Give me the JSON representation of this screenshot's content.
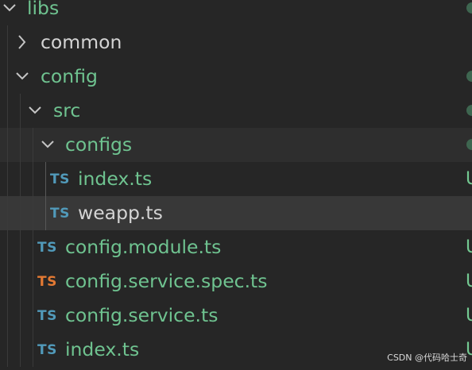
{
  "colors": {
    "background": "#262626",
    "folder_text": "#6fc390",
    "neutral_text": "#d4d4d4",
    "ts_blue": "#519aba",
    "ts_orange": "#e37933",
    "status_dot": "#3e6650",
    "untracked_badge": "#73c991"
  },
  "explorer": {
    "rows": [
      {
        "label": "libs",
        "type": "folder",
        "state": "expanded",
        "git": "dot"
      },
      {
        "label": "common",
        "type": "folder",
        "state": "collapsed",
        "git": "none"
      },
      {
        "label": "config",
        "type": "folder",
        "state": "expanded",
        "git": "dot"
      },
      {
        "label": "src",
        "type": "folder",
        "state": "expanded",
        "git": "dot"
      },
      {
        "label": "configs",
        "type": "folder",
        "state": "expanded",
        "git": "dot"
      },
      {
        "label": "index.ts",
        "type": "file",
        "icon": "TS",
        "icon_color": "blue",
        "git": "U"
      },
      {
        "label": "weapp.ts",
        "type": "file",
        "icon": "TS",
        "icon_color": "blue",
        "git": "none"
      },
      {
        "label": "config.module.ts",
        "type": "file",
        "icon": "TS",
        "icon_color": "blue",
        "git": "U"
      },
      {
        "label": "config.service.spec.ts",
        "type": "file",
        "icon": "TS",
        "icon_color": "orange",
        "git": "U"
      },
      {
        "label": "config.service.ts",
        "type": "file",
        "icon": "TS",
        "icon_color": "blue",
        "git": "U"
      },
      {
        "label": "index.ts",
        "type": "file",
        "icon": "TS",
        "icon_color": "blue",
        "git": "U"
      }
    ]
  },
  "watermark": "CSDN @代码哈士奇"
}
